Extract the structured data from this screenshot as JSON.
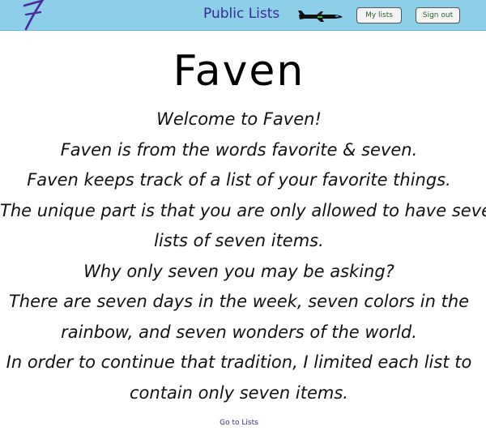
{
  "navbar": {
    "title": "Public Lists",
    "my_lists_label": "My lists",
    "sign_out_label": "Sign out",
    "logo_icon": "seven-logo-icon",
    "plane_icon": "airplane-icon",
    "background_color": "#8dcfe9",
    "title_color": "#3a2a8f"
  },
  "main": {
    "heading": "Faven",
    "paragraph_lines": [
      "Welcome to Faven!",
      "Faven is from the words favorite & seven.",
      "Faven keeps track of a list of your favorite things.",
      "The unique part is that you are only allowed to have seven",
      "lists of seven items.",
      "Why only seven you may be asking?",
      "There are seven days in the week, seven colors in the",
      "rainbow, and seven wonders of the world.",
      "In order to continue that tradition, I limited each list to",
      "contain only seven items."
    ]
  },
  "footer": {
    "link_label": "Go to Lists"
  }
}
